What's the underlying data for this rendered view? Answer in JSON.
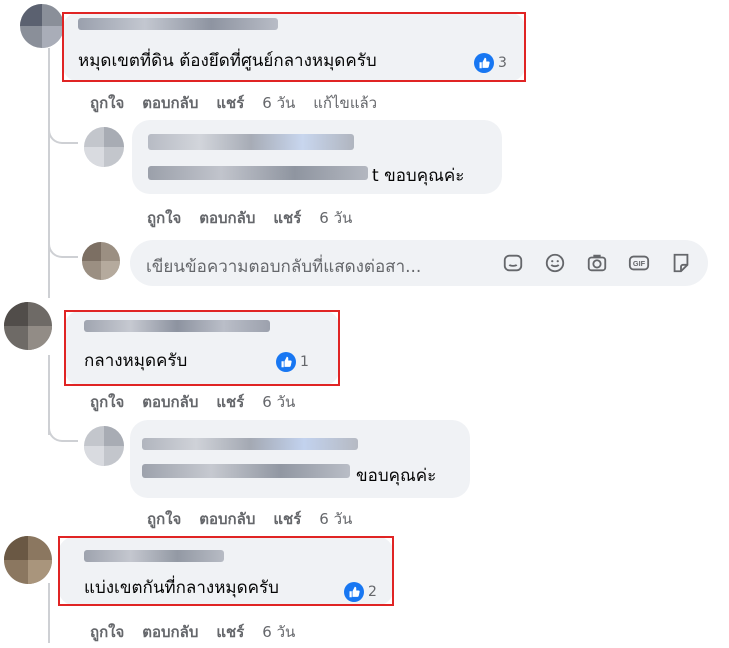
{
  "comments": [
    {
      "text": "หมุดเขตที่ดิน ต้องยึดที่ศูนย์กลางหมุดครับ",
      "reaction_count": "3",
      "actions": {
        "like": "ถูกใจ",
        "reply": "ตอบกลับ",
        "share": "แชร์",
        "time": "6 วัน",
        "edited": "แก้ไขแล้ว"
      },
      "reply": {
        "text": "t ขอบคุณค่ะ",
        "actions": {
          "like": "ถูกใจ",
          "reply": "ตอบกลับ",
          "share": "แชร์",
          "time": "6 วัน"
        }
      }
    },
    {
      "text": "กลางหมุดครับ",
      "reaction_count": "1",
      "actions": {
        "like": "ถูกใจ",
        "reply": "ตอบกลับ",
        "share": "แชร์",
        "time": "6 วัน"
      },
      "reply": {
        "text": "ขอบคุณค่ะ",
        "actions": {
          "like": "ถูกใจ",
          "reply": "ตอบกลับ",
          "share": "แชร์",
          "time": "6 วัน"
        }
      }
    },
    {
      "text": "แบ่งเขตกันที่กลางหมุดครับ",
      "reaction_count": "2",
      "actions": {
        "like": "ถูกใจ",
        "reply": "ตอบกลับ",
        "share": "แชร์",
        "time": "6 วัน"
      }
    }
  ],
  "reply_input": {
    "placeholder": "เขียนข้อความตอบกลับที่แสดงต่อสา...",
    "icons": [
      "sticker-face-icon",
      "emoji-icon",
      "camera-icon",
      "gif-icon",
      "sticker-icon"
    ]
  },
  "colors": {
    "accent": "#1877f2",
    "highlight": "#e02424",
    "bubble": "#f0f2f5",
    "meta": "#65676b"
  }
}
